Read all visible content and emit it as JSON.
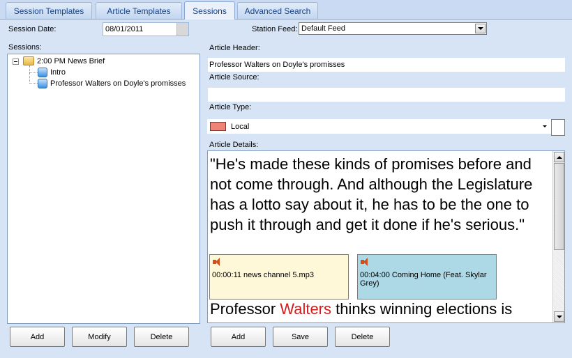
{
  "tabs": [
    {
      "label": "Session Templates"
    },
    {
      "label": "Article Templates"
    },
    {
      "label": "Sessions",
      "active": true
    },
    {
      "label": "Advanced Search"
    }
  ],
  "session_date": {
    "label": "Session Date:",
    "value": "08/01/2011"
  },
  "station_feed": {
    "label": "Station Feed:",
    "value": "Default Feed"
  },
  "sessions": {
    "label": "Sessions:",
    "tree": {
      "root": "2:00 PM News Brief",
      "children": [
        "Intro",
        "Professor Walters on Doyle's promisses"
      ]
    },
    "buttons": {
      "add": "Add",
      "modify": "Modify",
      "delete": "Delete"
    }
  },
  "article": {
    "header_label": "Article Header:",
    "header_value": "Professor Walters on Doyle's promisses",
    "source_label": "Article Source:",
    "source_value": "",
    "type_label": "Article Type:",
    "type_value": "Local",
    "type_color": "#ef8378",
    "details_label": "Article Details:",
    "quote": "\"He's made these kinds of promises before and not come through. And although the Legislature has a lotto say about it, he has to be the one to push it through and get it done if he's serious.\"",
    "clips": [
      {
        "text": "00:00:11 news channel 5.mp3",
        "color": "#fff8d8"
      },
      {
        "text": "00:04:00 Coming Home (Feat. Skylar Grey)",
        "color": "#add8e6"
      }
    ],
    "follow_pre": "Professor ",
    "follow_name": "Walters",
    "follow_post": " thinks winning elections is",
    "buttons": {
      "add": "Add",
      "save": "Save",
      "delete": "Delete"
    }
  }
}
